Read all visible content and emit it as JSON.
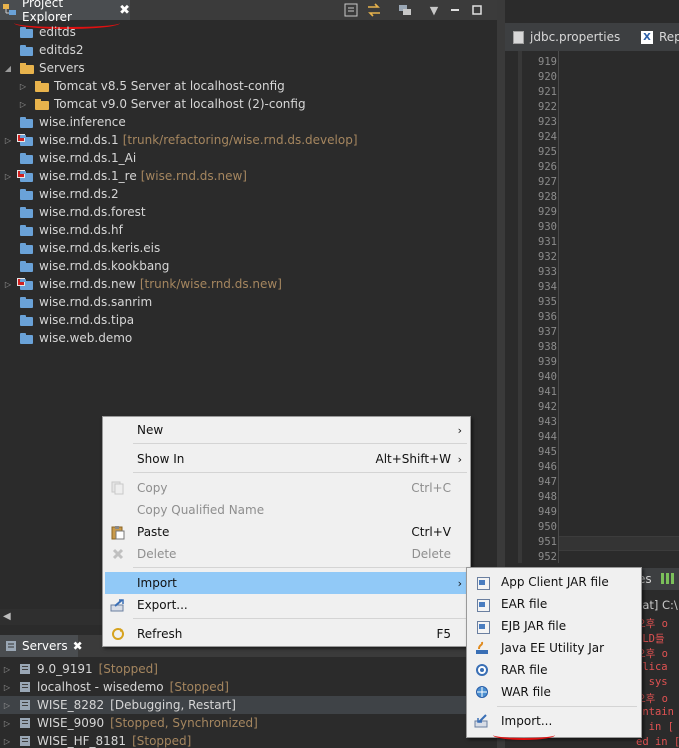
{
  "project_explorer": {
    "tab_label": "Project Explorer",
    "close_glyph": "✖",
    "tree": [
      {
        "label": "editds",
        "icon": "project-icon",
        "twisty": "",
        "deco": ""
      },
      {
        "label": "editds2",
        "icon": "project-icon",
        "twisty": "",
        "deco": ""
      },
      {
        "label": "Servers",
        "icon": "folder-icon",
        "twisty": "◢",
        "deco": ""
      },
      {
        "label": "Tomcat v8.5 Server at localhost-config",
        "icon": "folder-icon",
        "twisty": "▷",
        "deco": "",
        "indent": 1
      },
      {
        "label": "Tomcat v9.0 Server at localhost (2)-config",
        "icon": "folder-icon",
        "twisty": "▷",
        "deco": "",
        "indent": 1
      },
      {
        "label": "wise.inference",
        "icon": "project-icon",
        "twisty": "",
        "deco": ""
      },
      {
        "label": "wise.rnd.ds.1",
        "icon": "svn-project-icon",
        "twisty": "▷",
        "deco": "[trunk/refactoring/wise.rnd.ds.develop]"
      },
      {
        "label": "wise.rnd.ds.1_Ai",
        "icon": "project-icon",
        "twisty": "",
        "deco": ""
      },
      {
        "label": "wise.rnd.ds.1_re",
        "icon": "svn-project-icon",
        "twisty": "▷",
        "deco": "[wise.rnd.ds.new]"
      },
      {
        "label": "wise.rnd.ds.2",
        "icon": "project-icon",
        "twisty": "",
        "deco": ""
      },
      {
        "label": "wise.rnd.ds.forest",
        "icon": "project-icon",
        "twisty": "",
        "deco": ""
      },
      {
        "label": "wise.rnd.ds.hf",
        "icon": "project-icon",
        "twisty": "",
        "deco": ""
      },
      {
        "label": "wise.rnd.ds.keris.eis",
        "icon": "project-icon",
        "twisty": "",
        "deco": ""
      },
      {
        "label": "wise.rnd.ds.kookbang",
        "icon": "project-icon",
        "twisty": "",
        "deco": ""
      },
      {
        "label": "wise.rnd.ds.new",
        "icon": "svn-project-icon",
        "twisty": "▷",
        "deco": "[trunk/wise.rnd.ds.new]"
      },
      {
        "label": "wise.rnd.ds.sanrim",
        "icon": "project-icon",
        "twisty": "",
        "deco": ""
      },
      {
        "label": "wise.rnd.ds.tipa",
        "icon": "project-icon",
        "twisty": "",
        "deco": ""
      },
      {
        "label": "wise.web.demo",
        "icon": "project-icon",
        "twisty": "",
        "deco": ""
      }
    ]
  },
  "editor": {
    "tabs": [
      {
        "label": "jdbc.properties",
        "icon": "properties-file-icon"
      },
      {
        "label": "Repo",
        "icon": "xml-file-icon"
      }
    ],
    "line_numbers": [
      "919",
      "920",
      "921",
      "922",
      "923",
      "924",
      "925",
      "926",
      "927",
      "928",
      "929",
      "930",
      "931",
      "932",
      "933",
      "934",
      "935",
      "936",
      "937",
      "938",
      "939",
      "940",
      "941",
      "942",
      "943",
      "944",
      "945",
      "946",
      "947",
      "948",
      "949",
      "950",
      "951",
      "952"
    ]
  },
  "console": {
    "tab_label_tail": "es",
    "header": "cat] C:\\",
    "lines": [
      "오후 o",
      "TLD들",
      "오후 o",
      "plica",
      "t sys",
      "오후 o",
      "ontain",
      "g in [",
      "ed in ["
    ]
  },
  "servers_view": {
    "tab_label": "Servers",
    "close_glyph": "✖",
    "servers": [
      {
        "name": "9.0_9191",
        "state": "[Stopped]",
        "selected": false
      },
      {
        "name": "localhost - wisedemo",
        "state": "[Stopped]",
        "selected": false
      },
      {
        "name": "WISE_8282",
        "state": "[Debugging, Restart]",
        "selected": true
      },
      {
        "name": "WISE_9090",
        "state": "[Stopped, Synchronized]",
        "selected": false
      },
      {
        "name": "WISE_HF_8181",
        "state": "[Stopped]",
        "selected": false
      }
    ]
  },
  "context_menu": {
    "items": [
      {
        "label": "New",
        "accel": "",
        "submenu": true,
        "enabled": true,
        "icon": ""
      },
      {
        "label": "Show In",
        "accel": "Alt+Shift+W",
        "submenu": true,
        "enabled": true,
        "icon": ""
      },
      {
        "label": "Copy",
        "accel": "Ctrl+C",
        "submenu": false,
        "enabled": false,
        "icon": "copy-icon"
      },
      {
        "label": "Copy Qualified Name",
        "accel": "",
        "submenu": false,
        "enabled": false,
        "icon": "copy-qualified-icon"
      },
      {
        "label": "Paste",
        "accel": "Ctrl+V",
        "submenu": false,
        "enabled": true,
        "icon": "paste-icon"
      },
      {
        "label": "Delete",
        "accel": "Delete",
        "submenu": false,
        "enabled": false,
        "icon": "delete-icon"
      },
      {
        "label": "Import",
        "accel": "",
        "submenu": true,
        "enabled": true,
        "icon": "",
        "highlighted": true
      },
      {
        "label": "Export...",
        "accel": "",
        "submenu": false,
        "enabled": true,
        "icon": "export-icon"
      },
      {
        "label": "Refresh",
        "accel": "F5",
        "submenu": false,
        "enabled": true,
        "icon": "refresh-icon"
      }
    ]
  },
  "import_submenu": {
    "items": [
      {
        "label": "App Client JAR file",
        "icon": "app-client-jar-icon"
      },
      {
        "label": "EAR file",
        "icon": "ear-file-icon"
      },
      {
        "label": "EJB JAR file",
        "icon": "ejb-jar-icon"
      },
      {
        "label": "Java EE Utility Jar",
        "icon": "java-ee-utility-jar-icon"
      },
      {
        "label": "RAR file",
        "icon": "rar-file-icon"
      },
      {
        "label": "WAR file",
        "icon": "war-file-icon"
      },
      {
        "label": "Import...",
        "icon": "import-wizard-icon"
      }
    ]
  },
  "colors": {
    "annotation_red": "#e01010",
    "menu_highlight": "#91c9f7",
    "svn_decoration": "#a5865f"
  }
}
